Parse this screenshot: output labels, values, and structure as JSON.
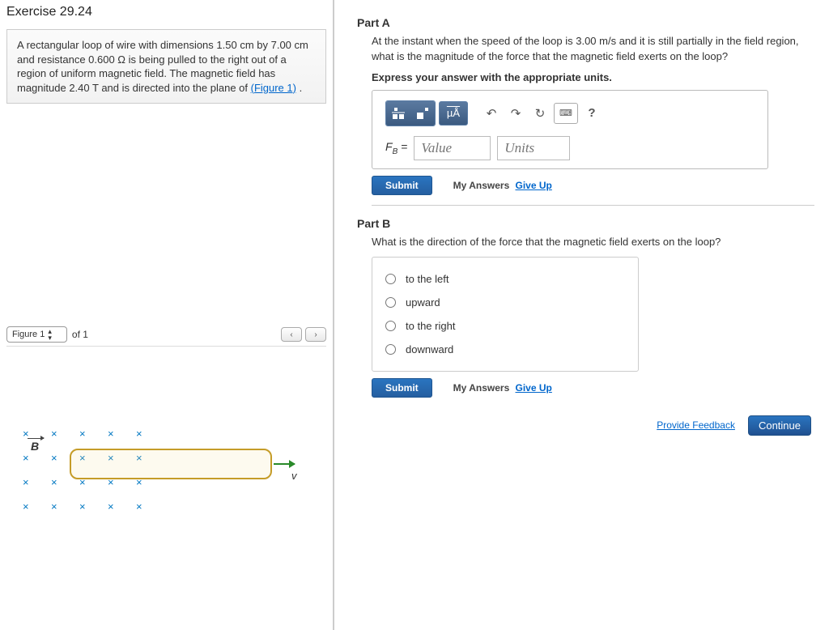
{
  "exercise": {
    "title": "Exercise 29.24"
  },
  "problem": {
    "text_pre": "A rectangular loop of wire with dimensions 1.50  cm by 7.00  cm and resistance 0.600  Ω is being pulled to the right out of a region of uniform magnetic field. The magnetic field has magnitude 2.40  T and is directed into the plane of ",
    "figure_link": "(Figure 1)",
    "text_post": " ."
  },
  "figure": {
    "selector_label": "Figure 1",
    "of_text": "of 1",
    "prev": "‹",
    "next": "›",
    "B_label": "B",
    "v_label": "v"
  },
  "partA": {
    "header": "Part A",
    "question": "At the instant when the speed of the loop is 3.00 m/s and it is still partially in the field region, what is the magnitude of the force that the magnetic field exerts on the loop?",
    "instruction": "Express your answer with the appropriate units.",
    "mu_label": "µÅ",
    "undo": "↶",
    "redo": "↷",
    "reset": "↻",
    "kbd": "⌨",
    "help": "?",
    "var_html": "F<sub>B</sub> =",
    "value_ph": "Value",
    "units_ph": "Units"
  },
  "submit": {
    "label": "Submit",
    "my_answers": "My Answers",
    "give_up": "Give Up"
  },
  "partB": {
    "header": "Part B",
    "question": "What is the direction of the force that the magnetic field exerts on the loop?",
    "choices": [
      "to the left",
      "upward",
      "to the right",
      "downward"
    ]
  },
  "footer": {
    "feedback": "Provide Feedback",
    "continue": "Continue"
  }
}
